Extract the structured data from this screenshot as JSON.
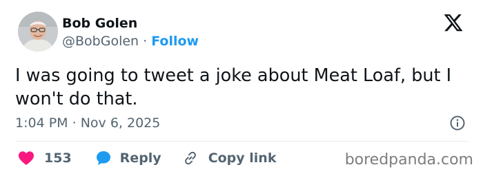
{
  "author": {
    "name": "Bob Golen",
    "handle": "@BobGolen",
    "separator": "·",
    "follow_label": "Follow"
  },
  "tweet": {
    "text": "I was going to tweet a joke about Meat Loaf, but I won't do that.",
    "time": "1:04 PM",
    "date_separator": "·",
    "date": "Nov 6, 2025"
  },
  "actions": {
    "like_count": "153",
    "reply_label": "Reply",
    "copy_link_label": "Copy link"
  },
  "watermark": "boredpanda.com",
  "icons": {
    "brand": "x-logo-icon",
    "info": "info-icon",
    "like": "heart-icon",
    "reply": "speech-bubble-icon",
    "copy": "link-icon"
  },
  "colors": {
    "text": "#0f1419",
    "secondary": "#536471",
    "accent": "#1d9bf0",
    "like": "#f91880",
    "divider": "#e6ecf0",
    "watermark": "#7d7d7d"
  }
}
